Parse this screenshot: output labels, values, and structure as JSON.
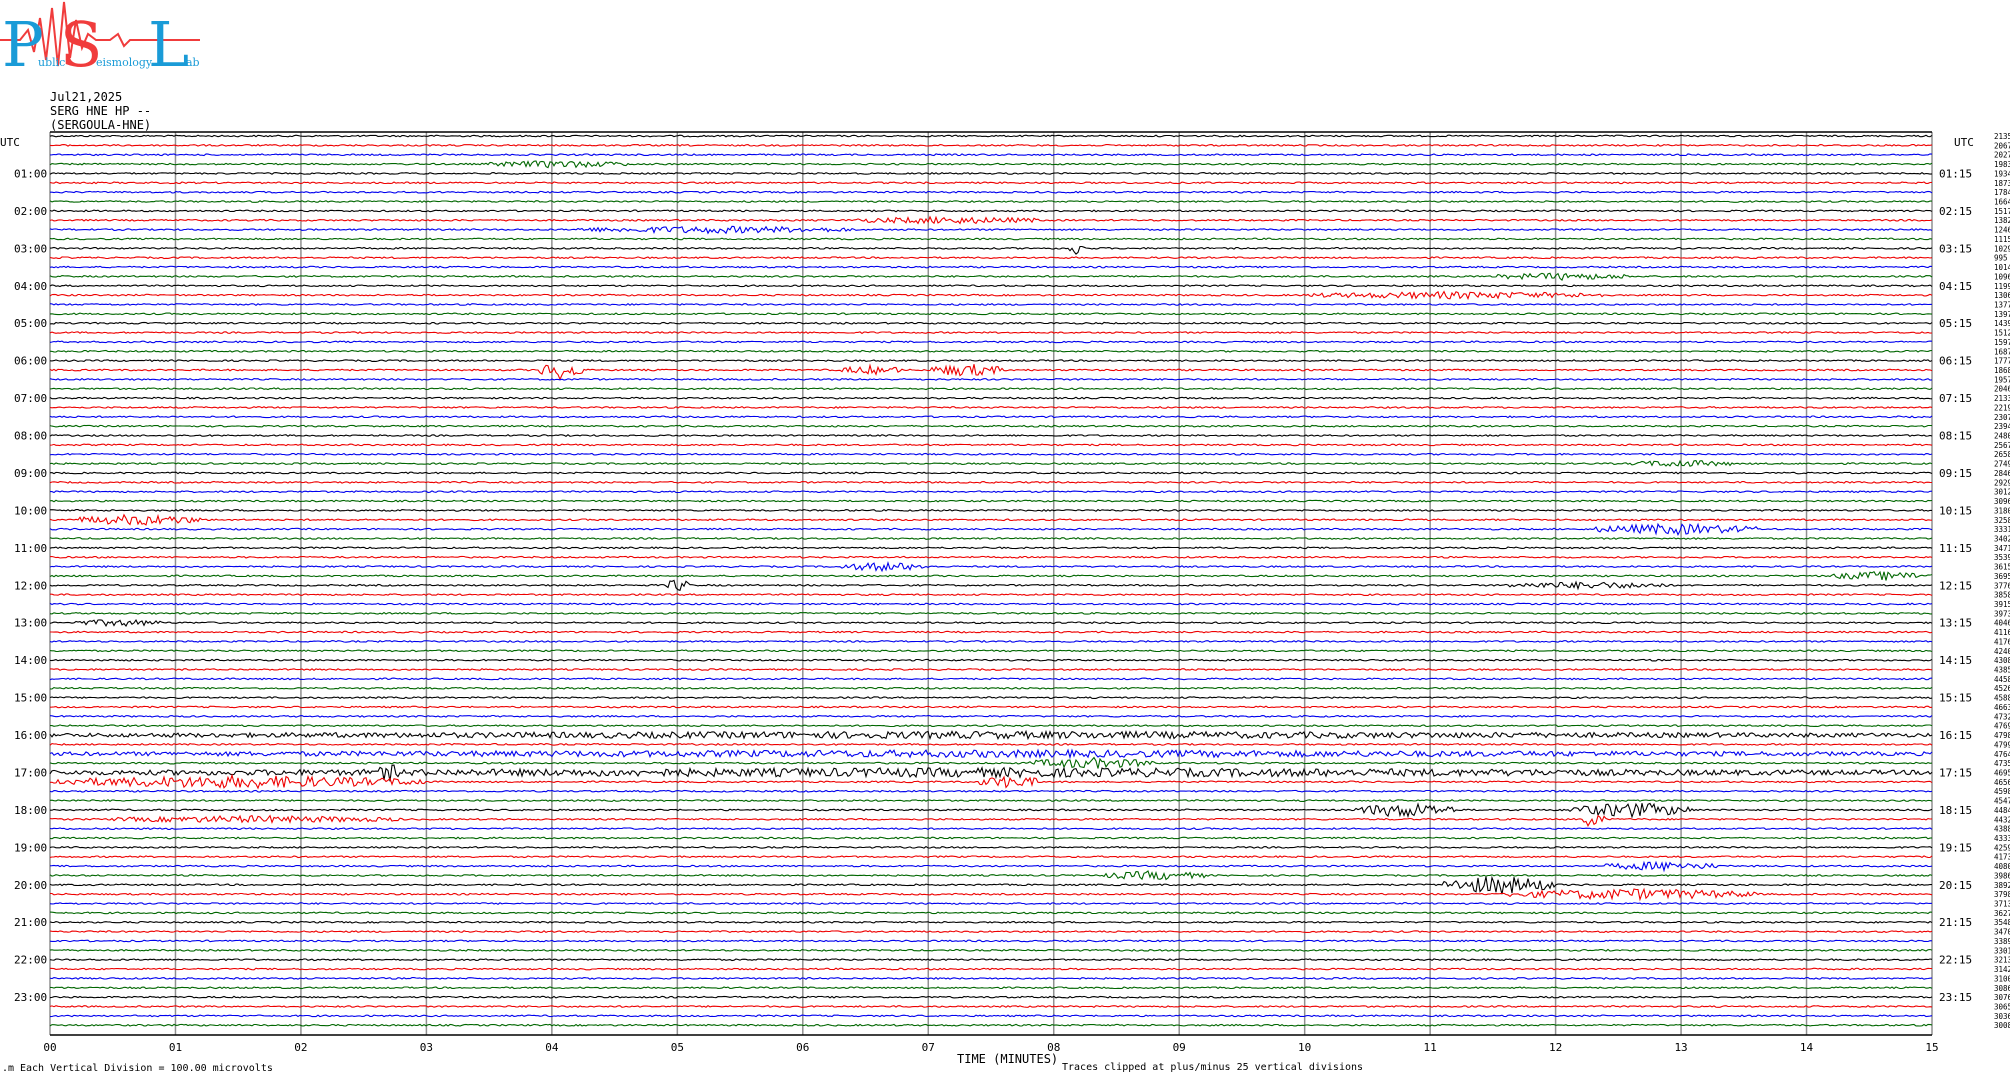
{
  "logo": {
    "letters": [
      "P",
      "S",
      "L"
    ],
    "small_text": [
      "ublic",
      "eismology",
      "ab"
    ]
  },
  "header": {
    "date": "Jul21,2025",
    "station": "SERG HNE HP --",
    "name": "(SERGOULA-HNE)"
  },
  "footer": {
    "scale_note": "Each Vertical Division =  100.00 microvolts",
    "clip_note": "Traces clipped at plus/minus 25 vertical divisions"
  },
  "colors": {
    "black": "#000000",
    "red": "#ee0000",
    "blue": "#0000ee",
    "green": "#006600",
    "grid": "#909090",
    "logo_blue": "#1a9bd7",
    "logo_red": "#f03c3c"
  },
  "chart_data": {
    "type": "line",
    "title": "Jul21,2025",
    "xlabel": "TIME (MINUTES)",
    "ylabel": "UTC",
    "xlim": [
      0,
      15
    ],
    "x_ticks": [
      "00",
      "01",
      "02",
      "03",
      "04",
      "05",
      "06",
      "07",
      "08",
      "09",
      "10",
      "11",
      "12",
      "13",
      "14",
      "15"
    ],
    "left_axis_title": "UTC",
    "right_axis_title": "UTC",
    "left_hour_labels": [
      "01:00",
      "02:00",
      "03:00",
      "04:00",
      "05:00",
      "06:00",
      "07:00",
      "08:00",
      "09:00",
      "10:00",
      "11:00",
      "12:00",
      "13:00",
      "14:00",
      "15:00",
      "16:00",
      "17:00",
      "18:00",
      "19:00",
      "20:00",
      "21:00",
      "22:00",
      "23:00"
    ],
    "right_hour_labels": [
      "01:15",
      "02:15",
      "03:15",
      "04:15",
      "05:15",
      "06:15",
      "07:15",
      "08:15",
      "09:15",
      "10:15",
      "11:15",
      "12:15",
      "13:15",
      "14:15",
      "15:15",
      "16:15",
      "17:15",
      "18:15",
      "19:15",
      "20:15",
      "21:15",
      "22:15",
      "23:15"
    ],
    "trace_count": 96,
    "trace_minutes": 15,
    "trace_color_cycle": [
      "black",
      "red",
      "blue",
      "green"
    ],
    "right_values": [
      "2135",
      "2067",
      "2027",
      "1983",
      "1934",
      "1873",
      "1784",
      "1664",
      "1517",
      "1382",
      "1246",
      "1115",
      "1029",
      "995",
      "1014",
      "1096",
      "1199",
      "1306",
      "1377",
      "1397",
      "1439",
      "1512",
      "1597",
      "1687",
      "1777",
      "1868",
      "1957",
      "2046",
      "2133",
      "2219",
      "2307",
      "2394",
      "2480",
      "2567",
      "2658",
      "2749",
      "2846",
      "2929",
      "3012",
      "3096",
      "3180",
      "3258",
      "3331",
      "3402",
      "3471",
      "3539",
      "3615",
      "3695",
      "3776",
      "3858",
      "3915",
      "3973",
      "4046",
      "4116",
      "4176",
      "4240",
      "4308",
      "4385",
      "4458",
      "4526",
      "4588",
      "4663",
      "4732",
      "4769",
      "4798",
      "4799",
      "4764",
      "4735",
      "4695",
      "4656",
      "4598",
      "4547",
      "4484",
      "4432",
      "4388",
      "4333",
      "4259",
      "4173",
      "4080",
      "3986",
      "3892",
      "3798",
      "3713",
      "3627",
      "3548",
      "3470",
      "3389",
      "3301",
      "3213",
      "3142",
      "3100",
      "3086",
      "3076",
      "3065",
      "3036",
      "3008"
    ],
    "events": [
      {
        "trace": 3,
        "start": 3.5,
        "end": 4.6,
        "amp": 3
      },
      {
        "trace": 10,
        "start": 4.2,
        "end": 6.4,
        "amp": 3
      },
      {
        "trace": 9,
        "start": 6.4,
        "end": 7.9,
        "amp": 3
      },
      {
        "trace": 12,
        "start": 8.1,
        "end": 8.25,
        "amp": 6
      },
      {
        "trace": 17,
        "start": 10.0,
        "end": 12.4,
        "amp": 3
      },
      {
        "trace": 15,
        "start": 11.5,
        "end": 12.6,
        "amp": 3
      },
      {
        "trace": 25,
        "start": 3.9,
        "end": 4.25,
        "amp": 9
      },
      {
        "trace": 25,
        "start": 6.3,
        "end": 6.8,
        "amp": 4
      },
      {
        "trace": 25,
        "start": 7.0,
        "end": 7.6,
        "amp": 6
      },
      {
        "trace": 35,
        "start": 12.6,
        "end": 13.4,
        "amp": 3
      },
      {
        "trace": 41,
        "start": 0.2,
        "end": 1.2,
        "amp": 5
      },
      {
        "trace": 42,
        "start": 12.3,
        "end": 13.6,
        "amp": 5
      },
      {
        "trace": 46,
        "start": 6.3,
        "end": 7.0,
        "amp": 4
      },
      {
        "trace": 47,
        "start": 14.2,
        "end": 15.0,
        "amp": 4
      },
      {
        "trace": 48,
        "start": 4.9,
        "end": 5.1,
        "amp": 6
      },
      {
        "trace": 48,
        "start": 11.6,
        "end": 12.9,
        "amp": 3
      },
      {
        "trace": 52,
        "start": 0.2,
        "end": 0.9,
        "amp": 3
      },
      {
        "trace": 64,
        "start": 0.0,
        "end": 15.0,
        "amp": 3
      },
      {
        "trace": 66,
        "start": 0.0,
        "end": 15.0,
        "amp": 3
      },
      {
        "trace": 67,
        "start": 7.8,
        "end": 8.8,
        "amp": 5
      },
      {
        "trace": 68,
        "start": 0.0,
        "end": 15.0,
        "amp": 4
      },
      {
        "trace": 68,
        "start": 2.6,
        "end": 2.8,
        "amp": 9
      },
      {
        "trace": 69,
        "start": 0.0,
        "end": 3.0,
        "amp": 6
      },
      {
        "trace": 69,
        "start": 7.4,
        "end": 7.9,
        "amp": 6
      },
      {
        "trace": 72,
        "start": 10.4,
        "end": 11.2,
        "amp": 7
      },
      {
        "trace": 72,
        "start": 12.1,
        "end": 13.1,
        "amp": 7
      },
      {
        "trace": 73,
        "start": 12.2,
        "end": 12.4,
        "amp": 8
      },
      {
        "trace": 73,
        "start": 0.5,
        "end": 2.8,
        "amp": 3
      },
      {
        "trace": 79,
        "start": 8.4,
        "end": 9.2,
        "amp": 4
      },
      {
        "trace": 80,
        "start": 11.1,
        "end": 12.0,
        "amp": 9
      },
      {
        "trace": 81,
        "start": 11.6,
        "end": 13.6,
        "amp": 5
      },
      {
        "trace": 78,
        "start": 12.4,
        "end": 13.3,
        "amp": 4
      }
    ]
  }
}
